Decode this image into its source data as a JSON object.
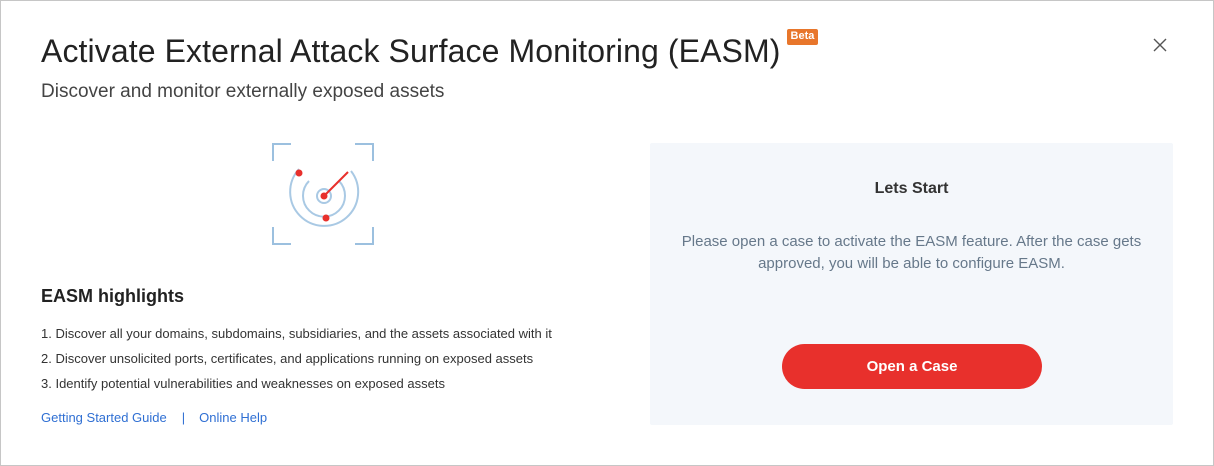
{
  "header": {
    "title": "Activate External Attack Surface Monitoring (EASM)",
    "badge": "Beta",
    "subtitle": "Discover and monitor externally exposed assets",
    "close_icon": "close-icon"
  },
  "illustration": {
    "icon": "radar-icon"
  },
  "highlights": {
    "title": "EASM highlights",
    "items": [
      "1. Discover all your domains, subdomains, subsidiaries, and the assets associated with it",
      "2. Discover unsolicited ports, certificates, and applications running on exposed assets",
      "3. Identify potential vulnerabilities and weaknesses on exposed assets"
    ],
    "links": {
      "guide": "Getting Started Guide",
      "separator": "|",
      "help": "Online Help"
    }
  },
  "panel": {
    "title": "Lets Start",
    "text": "Please open a case to activate the EASM feature. After the case gets approved, you will be able to configure EASM.",
    "button": "Open a Case"
  },
  "colors": {
    "accent": "#e8302c",
    "badge": "#e8762b",
    "link": "#2f6fd3",
    "panel_bg": "#f4f7fb"
  }
}
